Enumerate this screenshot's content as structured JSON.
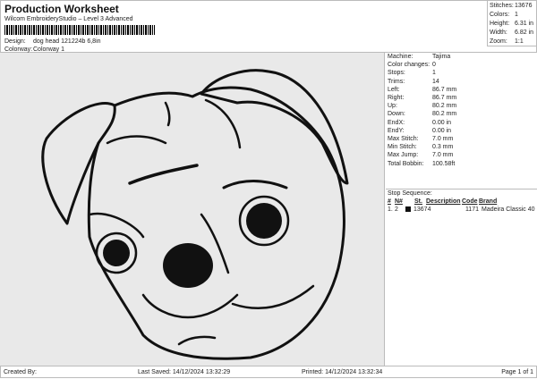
{
  "header": {
    "title": "Production Worksheet",
    "subtitle": "Wilcom EmbroideryStudio – Level 3 Advanced",
    "design_label": "Design:",
    "design_value": "dog head 121224b 6,8in",
    "colorway_label": "Colorway:",
    "colorway_value": "Colorway 1"
  },
  "stats": [
    {
      "label": "Stitches:",
      "value": "13676"
    },
    {
      "label": "Colors:",
      "value": "1"
    },
    {
      "label": "Height:",
      "value": "6.31 in"
    },
    {
      "label": "Width:",
      "value": "6.82 in"
    },
    {
      "label": "Zoom:",
      "value": "1:1"
    }
  ],
  "info": [
    {
      "label": "Machine:",
      "value": "Tajima"
    },
    {
      "label": "Color changes:",
      "value": "0"
    },
    {
      "label": "Stops:",
      "value": "1"
    },
    {
      "label": "Trims:",
      "value": "14"
    },
    {
      "label": "Left:",
      "value": "86.7 mm"
    },
    {
      "label": "Right:",
      "value": "86.7 mm"
    },
    {
      "label": "Up:",
      "value": "80.2 mm"
    },
    {
      "label": "Down:",
      "value": "80.2 mm"
    },
    {
      "label": "EndX:",
      "value": "0.00 in"
    },
    {
      "label": "EndY:",
      "value": "0.00 in"
    },
    {
      "label": "Max Stitch:",
      "value": "7.0 mm"
    },
    {
      "label": "Min Stitch:",
      "value": "0.3 mm"
    },
    {
      "label": "Max Jump:",
      "value": "7.0 mm"
    },
    {
      "label": "Total Bobbin:",
      "value": "100.58ft"
    }
  ],
  "sequence": {
    "title": "Stop Sequence:",
    "headers": [
      "#",
      "N#",
      "St.",
      "Description",
      "Code",
      "Brand"
    ],
    "rows": [
      {
        "num": "1.",
        "n": "2",
        "color": "#111111",
        "st": "13674",
        "desc": "",
        "code": "1171",
        "brand": "Madeira Classic 40"
      }
    ]
  },
  "footer": {
    "created": "Created By:",
    "saved": "Last Saved: 14/12/2024 13:32:29",
    "printed": "Printed: 14/12/2024 13:32:34",
    "page": "Page 1 of 1"
  }
}
